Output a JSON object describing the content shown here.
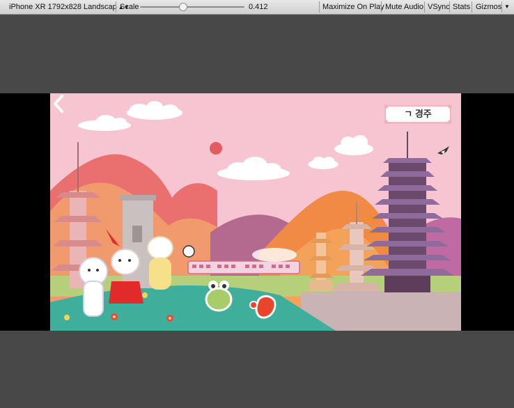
{
  "toolbar": {
    "device_select": "iPhone XR 1792x828 Landscap",
    "scale_label": "Scale",
    "scale_value": "0.412",
    "scale_fraction": 0.412,
    "maximize_on_play": "Maximize On Play",
    "mute_audio": "Mute Audio",
    "vsync": "VSync",
    "stats": "Stats",
    "gizmos": "Gizmos"
  },
  "game": {
    "city_badge": "ㄱ 경주",
    "colors": {
      "sky": "#f7c6d2",
      "mountain_red": "#e8646a",
      "mountain_orange": "#f08a44",
      "ground_teal": "#3fae9b",
      "pagoda_purple": "#7a5a8a",
      "sun": "#e25b5f"
    },
    "icons": {
      "back": "chevron-left-icon",
      "bird": "magpie-icon"
    }
  }
}
